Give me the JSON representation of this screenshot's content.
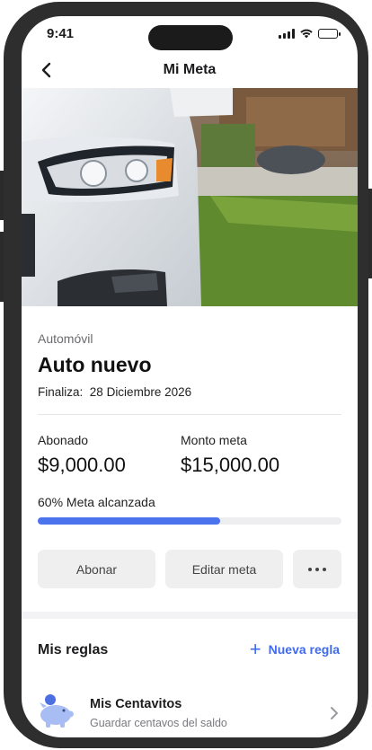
{
  "status_bar": {
    "time": "9:41"
  },
  "nav": {
    "title": "Mi Meta"
  },
  "goal": {
    "category": "Automóvil",
    "name": "Auto nuevo",
    "end_label": "Finaliza:",
    "end_date": "28 Diciembre 2026",
    "deposited_label": "Abonado",
    "deposited_value": "$9,000.00",
    "target_label": "Monto meta",
    "target_value": "$15,000.00",
    "progress_text": "60% Meta alcanzada",
    "progress_fraction": 0.6
  },
  "actions": {
    "deposit_label": "Abonar",
    "edit_label": "Editar meta",
    "more_icon": "more-horizontal-icon"
  },
  "rules": {
    "title": "Mis reglas",
    "new_rule_label": "Nueva regla",
    "items": [
      {
        "name": "Mis Centavitos",
        "description": "Guardar centavos del saldo",
        "icon": "piggy-bank-icon"
      }
    ]
  },
  "colors": {
    "accent": "#4b73ee",
    "link": "#3f6bec",
    "frame": "#2e2e2e",
    "button_bg": "#efefef"
  }
}
